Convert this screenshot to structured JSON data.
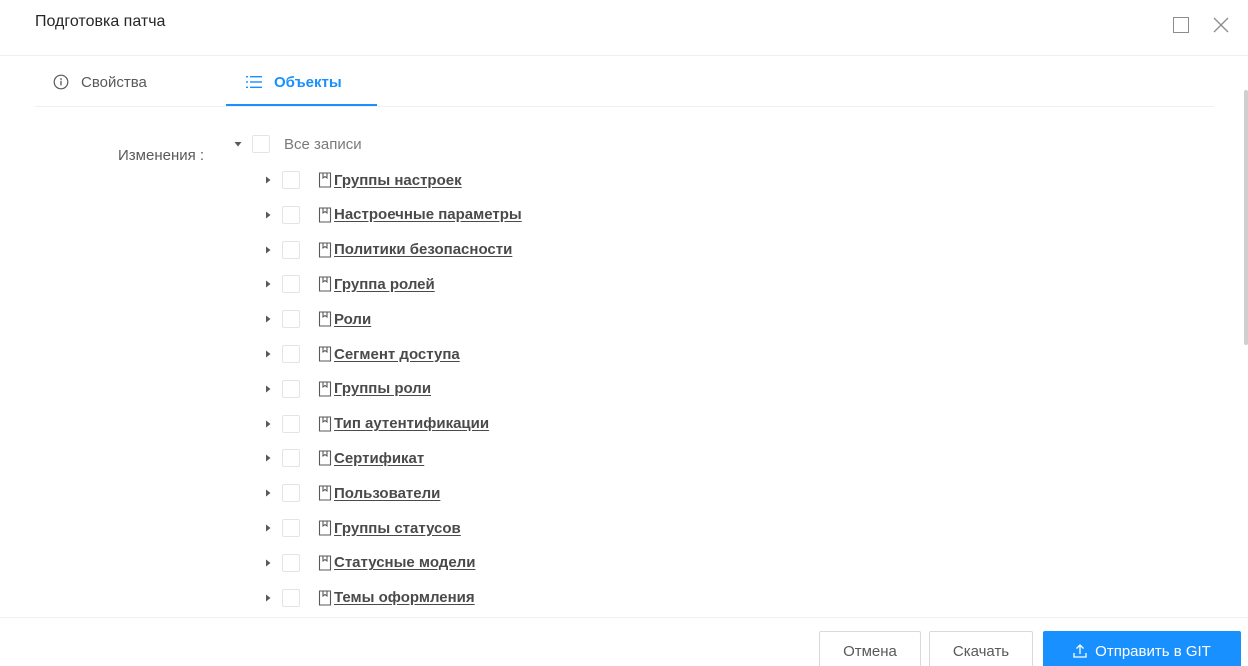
{
  "modal": {
    "title": "Подготовка патча"
  },
  "tabs": [
    {
      "label": "Свойства",
      "icon": "info-circle-icon",
      "active": false
    },
    {
      "label": "Объекты",
      "icon": "list-icon",
      "active": true
    }
  ],
  "form": {
    "label": "Изменения :"
  },
  "tree": {
    "root_label": "Все записи",
    "nodes": [
      {
        "label": "Группы настроек",
        "icon": "document-icon"
      },
      {
        "label": "Настроечные параметры",
        "icon": "document-icon"
      },
      {
        "label": "Политики безопасности",
        "icon": "document-icon"
      },
      {
        "label": "Группа ролей",
        "icon": "document-icon"
      },
      {
        "label": "Роли",
        "icon": "document-icon"
      },
      {
        "label": "Сегмент доступа",
        "icon": "document-icon"
      },
      {
        "label": "Группы роли",
        "icon": "document-icon"
      },
      {
        "label": "Тип аутентификации",
        "icon": "document-icon"
      },
      {
        "label": "Сертификат",
        "icon": "document-icon"
      },
      {
        "label": "Пользователи",
        "icon": "document-icon"
      },
      {
        "label": "Группы статусов",
        "icon": "document-icon"
      },
      {
        "label": "Статусные модели",
        "icon": "document-icon"
      },
      {
        "label": "Темы оформления",
        "icon": "document-icon"
      }
    ]
  },
  "footer": {
    "cancel_label": "Отмена",
    "download_label": "Скачать",
    "git_label": "Отправить в GIT",
    "git_icon": "upload-icon"
  },
  "colors": {
    "accent": "#1890ff",
    "text": "#262626",
    "muted": "#595959",
    "border": "#d9d9d9"
  }
}
